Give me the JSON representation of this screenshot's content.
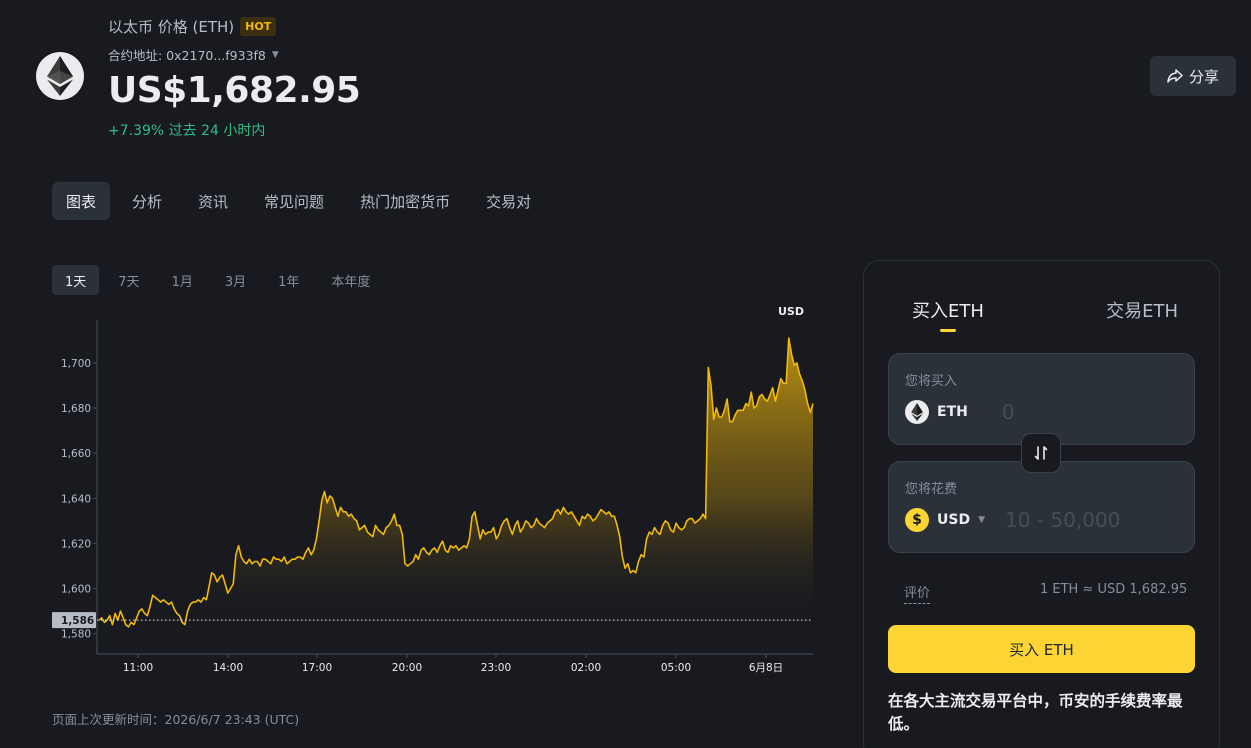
{
  "header": {
    "title": "以太币 价格 (ETH)",
    "hot_badge": "HOT",
    "contract": "合约地址: 0x2170...f933f8",
    "price": "US$1,682.95",
    "change": "+7.39% 过去 24 小时内",
    "share_label": "分享",
    "logo_icon": "ethereum-icon"
  },
  "tabs": [
    "图表",
    "分析",
    "资讯",
    "常见问题",
    "热门加密货币",
    "交易对"
  ],
  "active_tab": 0,
  "ranges": [
    "1天",
    "7天",
    "1月",
    "3月",
    "1年",
    "本年度"
  ],
  "active_range": 0,
  "updated": "页面上次更新时间：2026/6/7 23:43 (UTC)",
  "colors": {
    "accent": "#fcd535",
    "line": "#f0b90b",
    "positive": "#2ebd85",
    "background": "#181a20"
  },
  "chart_data": {
    "type": "area",
    "currency_label": "USD",
    "y_ticks": [
      "1,700",
      "1,680",
      "1,660",
      "1,640",
      "1,620",
      "1,600",
      "1,580"
    ],
    "x_ticks": [
      "11:00",
      "14:00",
      "17:00",
      "20:00",
      "23:00",
      "02:00",
      "05:00",
      "6月8日"
    ],
    "ylim": [
      1571,
      1719
    ],
    "open_price": 1586,
    "open_price_label": "1,586",
    "series": [
      {
        "values": [
          1586,
          1587,
          1585,
          1586,
          1588,
          1584,
          1589,
          1586,
          1590,
          1587,
          1584,
          1583,
          1585,
          1584,
          1587,
          1590,
          1591,
          1589,
          1588,
          1592,
          1597,
          1596,
          1595,
          1594,
          1595,
          1594,
          1593,
          1594,
          1591,
          1589,
          1588,
          1585,
          1584,
          1590,
          1593,
          1594,
          1594,
          1595,
          1594,
          1596,
          1595,
          1601,
          1607,
          1606,
          1603,
          1605,
          1606,
          1602,
          1598,
          1600,
          1602,
          1615,
          1619,
          1614,
          1612,
          1611,
          1613,
          1611,
          1612,
          1612,
          1610,
          1613,
          1613,
          1612,
          1611,
          1614,
          1613,
          1613,
          1612,
          1614,
          1611,
          1612,
          1613,
          1613,
          1614,
          1614,
          1613,
          1616,
          1618,
          1615,
          1617,
          1622,
          1630,
          1639,
          1643,
          1638,
          1641,
          1640,
          1636,
          1632,
          1636,
          1634,
          1634,
          1632,
          1633,
          1631,
          1630,
          1626,
          1627,
          1628,
          1625,
          1624,
          1623,
          1628,
          1626,
          1625,
          1624,
          1627,
          1628,
          1630,
          1633,
          1628,
          1628,
          1624,
          1611,
          1610,
          1611,
          1612,
          1615,
          1613,
          1617,
          1618,
          1616,
          1615,
          1617,
          1618,
          1616,
          1619,
          1621,
          1617,
          1616,
          1619,
          1618,
          1619,
          1617,
          1618,
          1619,
          1618,
          1622,
          1632,
          1634,
          1628,
          1622,
          1626,
          1624,
          1625,
          1625,
          1627,
          1622,
          1624,
          1628,
          1630,
          1631,
          1627,
          1624,
          1628,
          1630,
          1625,
          1627,
          1630,
          1629,
          1627,
          1628,
          1631,
          1629,
          1628,
          1627,
          1629,
          1630,
          1631,
          1634,
          1635,
          1633,
          1636,
          1634,
          1633,
          1634,
          1632,
          1630,
          1628,
          1632,
          1631,
          1633,
          1632,
          1630,
          1631,
          1633,
          1635,
          1634,
          1633,
          1634,
          1632,
          1632,
          1628,
          1623,
          1614,
          1609,
          1611,
          1607,
          1608,
          1607,
          1612,
          1615,
          1614,
          1622,
          1625,
          1624,
          1627,
          1625,
          1624,
          1628,
          1630,
          1629,
          1626,
          1625,
          1629,
          1627,
          1626,
          1627,
          1630,
          1631,
          1631,
          1629,
          1630,
          1631,
          1633,
          1631,
          1698,
          1690,
          1675,
          1680,
          1676,
          1676,
          1679,
          1684,
          1674,
          1674,
          1677,
          1679,
          1679,
          1679,
          1682,
          1681,
          1687,
          1680,
          1681,
          1685,
          1686,
          1684,
          1683,
          1686,
          1689,
          1683,
          1688,
          1693,
          1691,
          1691,
          1711,
          1704,
          1699,
          1700,
          1695,
          1692,
          1688,
          1682,
          1678,
          1682
        ]
      }
    ]
  },
  "trade": {
    "tab_buy": "买入ETH",
    "tab_trade": "交易ETH",
    "buy_label": "您将买入",
    "buy_symbol": "ETH",
    "buy_placeholder": "0",
    "spend_label": "您将花费",
    "spend_symbol": "USD",
    "spend_placeholder": "10 - 50,000",
    "rate_label": "评价",
    "rate_value": "1 ETH ≈ USD 1,682.95",
    "cta": "买入 ETH",
    "note": "在各大主流交易平台中，币安的手续费率最低。"
  }
}
